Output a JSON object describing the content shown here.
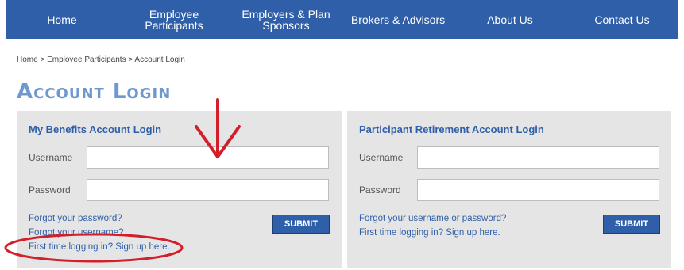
{
  "nav": {
    "items": [
      {
        "label": "Home"
      },
      {
        "label": "Employee Participants"
      },
      {
        "label": "Employers & Plan Sponsors"
      },
      {
        "label": "Brokers & Advisors"
      },
      {
        "label": "About Us"
      },
      {
        "label": "Contact Us"
      }
    ]
  },
  "breadcrumb": "Home > Employee Participants > Account Login",
  "page_title": "Account Login",
  "panels": [
    {
      "title": "My Benefits Account Login",
      "username_label": "Username",
      "password_label": "Password",
      "username_value": "",
      "password_value": "",
      "submit_label": "SUBMIT",
      "links": [
        "Forgot your password?",
        "Forgot your username?",
        "First time logging in? Sign up here."
      ]
    },
    {
      "title": "Participant Retirement Account Login",
      "username_label": "Username",
      "password_label": "Password",
      "username_value": "",
      "password_value": "",
      "submit_label": "SUBMIT",
      "links": [
        "Forgot your username or password?",
        "First time logging in? Sign up here."
      ]
    }
  ],
  "colors": {
    "nav_bg": "#2f5fa8",
    "title_color": "#6f98cf",
    "panel_bg": "#e5e5e5",
    "annotation_red": "#d21f2a"
  },
  "annotation": {
    "arrow": "down-arrow-icon",
    "circle": "ellipse-highlight"
  }
}
